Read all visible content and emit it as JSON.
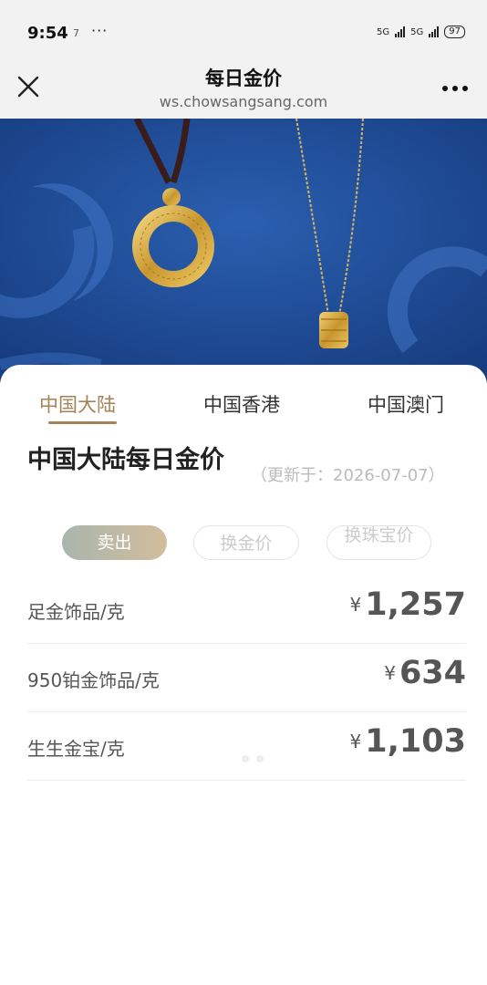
{
  "status_bar": {
    "time": "9:54",
    "notification": "7",
    "dots": "···",
    "network1": "5G",
    "network2": "5G",
    "battery": "97"
  },
  "header": {
    "title": "每日金价",
    "url": "ws.chowsangsang.com"
  },
  "tabs": [
    {
      "label": "中国大陆",
      "active": true
    },
    {
      "label": "中国香港",
      "active": false
    },
    {
      "label": "中国澳门",
      "active": false
    }
  ],
  "section": {
    "title": "中国大陆每日金价",
    "updated": "（更新于：2026-07-07）"
  },
  "price_types": [
    {
      "label": "卖出",
      "active": true
    },
    {
      "label": "换金价",
      "active": false
    },
    {
      "label": "换珠宝价",
      "active": false
    }
  ],
  "prices": [
    {
      "label": "足金饰品/克",
      "currency": "¥",
      "value": "1,257"
    },
    {
      "label": "950铂金饰品/克",
      "currency": "¥",
      "value": "634"
    },
    {
      "label": "生生金宝/克",
      "currency": "¥",
      "value": "1,103"
    }
  ],
  "colors": {
    "accent": "#a68259",
    "banner": "#1f4d9a"
  }
}
